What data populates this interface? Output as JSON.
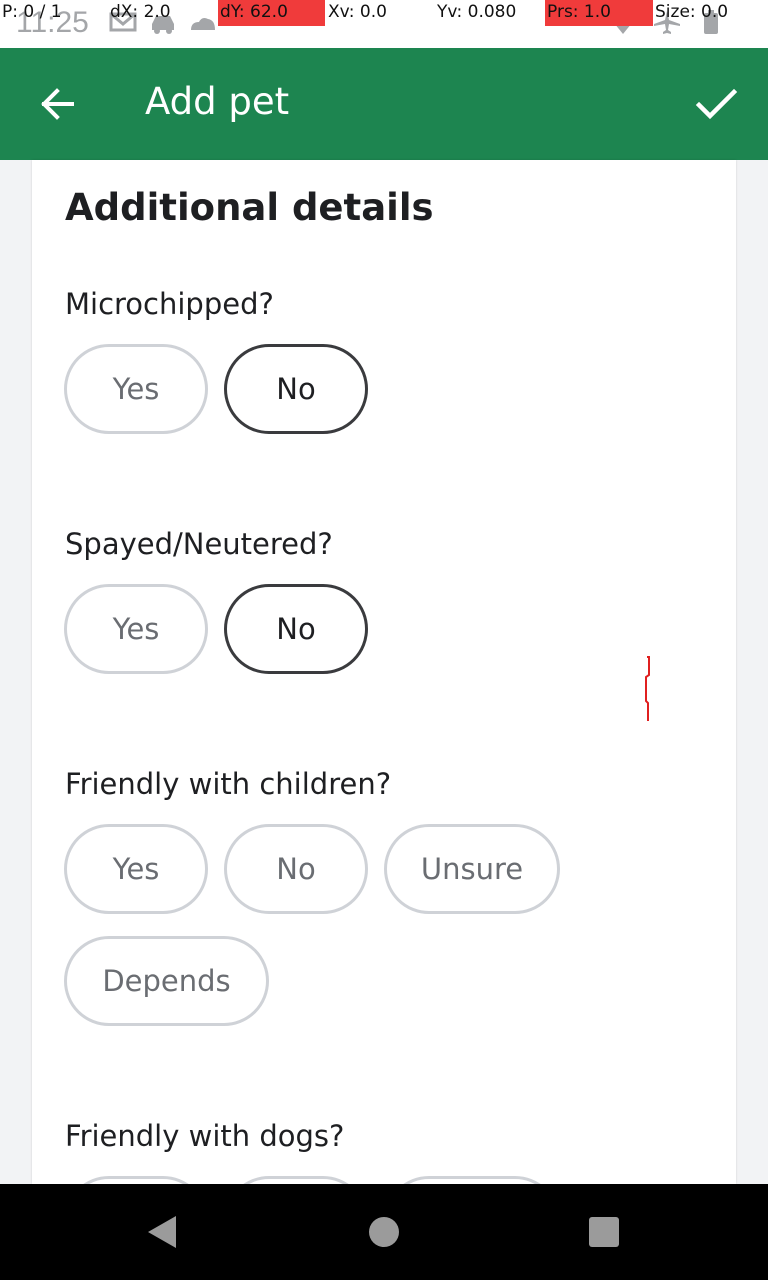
{
  "status_bar": {
    "time": "11:25",
    "debug": {
      "p": "P: 0 / 1",
      "dx": "dX: 2.0",
      "dy": "dY: 62.0",
      "xv": "Xv: 0.0",
      "yv": "Yv: 0.080",
      "prs": "Prs: 1.0",
      "size": "Size: 0.0"
    },
    "highlight_color": "#f03b3b"
  },
  "app_bar": {
    "title": "Add pet",
    "back_icon": "arrow-left-icon",
    "confirm_icon": "check-icon",
    "color": "#1d8550"
  },
  "card": {
    "section_title": "Additional details",
    "questions": [
      {
        "label": "Microchipped?",
        "options": [
          {
            "label": "Yes",
            "selected": false
          },
          {
            "label": "No",
            "selected": true
          }
        ]
      },
      {
        "label": "Spayed/Neutered?",
        "options": [
          {
            "label": "Yes",
            "selected": false
          },
          {
            "label": "No",
            "selected": true
          }
        ]
      },
      {
        "label": "Friendly with children?",
        "options": [
          {
            "label": "Yes",
            "selected": false
          },
          {
            "label": "No",
            "selected": false
          },
          {
            "label": "Unsure",
            "selected": false
          },
          {
            "label": "Depends",
            "selected": false
          }
        ]
      },
      {
        "label": "Friendly with dogs?"
      }
    ]
  },
  "nav_bar": {
    "back_icon": "triangle-back-icon",
    "home_icon": "circle-home-icon",
    "recents_icon": "square-recents-icon"
  }
}
